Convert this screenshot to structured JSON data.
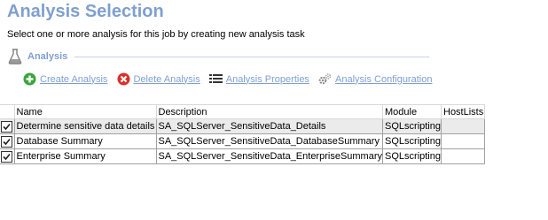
{
  "header": {
    "title": "Analysis Selection",
    "subtitle": "Select one or more analysis for this job by creating new analysis task"
  },
  "section": {
    "label": "Analysis"
  },
  "toolbar": {
    "create": "Create Analysis",
    "delete": "Delete Analysis",
    "properties": "Analysis Properties",
    "configuration": "Analysis Configuration"
  },
  "colors": {
    "accent": "#7f9fd0",
    "create_icon": "#3aa53a",
    "delete_icon": "#d9302c"
  },
  "table": {
    "columns": [
      "",
      "Name",
      "Description",
      "Module",
      "HostLists"
    ],
    "rows": [
      {
        "checked": true,
        "name": "Determine sensitive data details",
        "description": "SA_SQLServer_SensitiveData_Details",
        "module": "SQLscripting",
        "hostlists": ""
      },
      {
        "checked": true,
        "name": "Database Summary",
        "description": "SA_SQLServer_SensitiveData_DatabaseSummary",
        "module": "SQLscripting",
        "hostlists": ""
      },
      {
        "checked": true,
        "name": "Enterprise Summary",
        "description": "SA_SQLServer_SensitiveData_EnterpriseSummary",
        "module": "SQLscripting",
        "hostlists": ""
      }
    ]
  }
}
